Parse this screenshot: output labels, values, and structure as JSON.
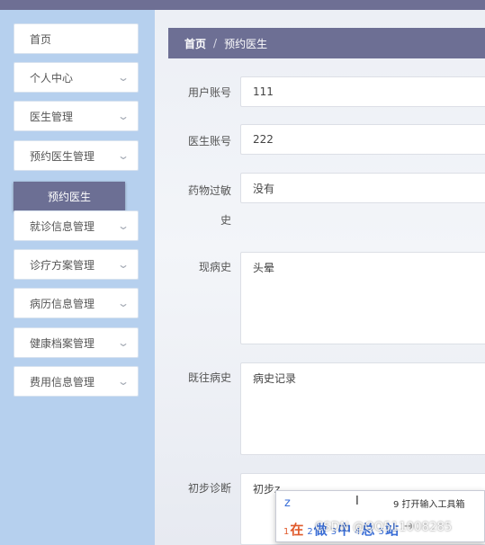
{
  "sidebar": {
    "items": [
      {
        "label": "首页",
        "chevron": false
      },
      {
        "label": "个人中心",
        "chevron": true
      },
      {
        "label": "医生管理",
        "chevron": true
      },
      {
        "label": "预约医生管理",
        "chevron": true
      },
      {
        "label": "就诊信息管理",
        "chevron": true
      },
      {
        "label": "诊疗方案管理",
        "chevron": true
      },
      {
        "label": "病历信息管理",
        "chevron": true
      },
      {
        "label": "健康档案管理",
        "chevron": true
      },
      {
        "label": "费用信息管理",
        "chevron": true
      }
    ],
    "active_sub": "预约医生",
    "chevron_icon": "chevron-down-icon"
  },
  "breadcrumb": {
    "home": "首页",
    "separator": "/",
    "current": "预约医生"
  },
  "form": {
    "user_account": {
      "label": "用户账号",
      "value": "111"
    },
    "doctor_account": {
      "label": "医生账号",
      "value": "222"
    },
    "drug_allergy": {
      "label_line1": "药物过敏",
      "label_line2": "史",
      "value": "没有"
    },
    "present_illness": {
      "label": "现病史",
      "value": "头晕"
    },
    "past_history": {
      "label": "既往病史",
      "value": "病史记录"
    },
    "initial_diagnosis": {
      "label": "初步诊断",
      "value": "初步z"
    }
  },
  "ime": {
    "input_code": "z",
    "tool_label": "9 打开输入工具箱",
    "candidates": [
      {
        "index": "1",
        "text": "在"
      },
      {
        "index": "2",
        "text": "做"
      },
      {
        "index": "3",
        "text": "中"
      },
      {
        "index": "4",
        "text": "总"
      },
      {
        "index": "5",
        "text": "站"
      }
    ],
    "next_arrow": "→"
  },
  "watermark": "CSDN @QQ511008285",
  "colors": {
    "header": "#6e6f94",
    "sidebar_bg": "#b6d0ee",
    "active_sub_bg": "#6c6f94"
  }
}
